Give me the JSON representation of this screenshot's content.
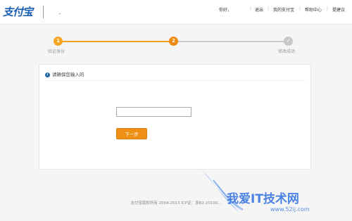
{
  "header": {
    "logo": "支付宝",
    "nav": {
      "greeting": "你好，",
      "logout": "退出",
      "my_account": "我的支付宝",
      "help": "帮助中心",
      "feedback": "提建议"
    }
  },
  "steps": [
    {
      "number": "1",
      "label": "验证身份",
      "state": "done"
    },
    {
      "number": "2",
      "label": "",
      "state": "current"
    },
    {
      "number": "✓",
      "label": "修改成功",
      "state": "pending"
    }
  ],
  "panel": {
    "title": "请确保您输入的",
    "input_value": "",
    "next_button": "下一步"
  },
  "footer": {
    "copyright": "支付宝版权所有 2004-2013 ICP证：浙B2-20100..."
  },
  "watermark": {
    "text": "我爱IT技术网",
    "url": "www.52ij.com"
  },
  "colors": {
    "accent_orange": "#f0a21a",
    "brand_blue": "#1a5fb4",
    "step_gray": "#c8c8c8"
  }
}
